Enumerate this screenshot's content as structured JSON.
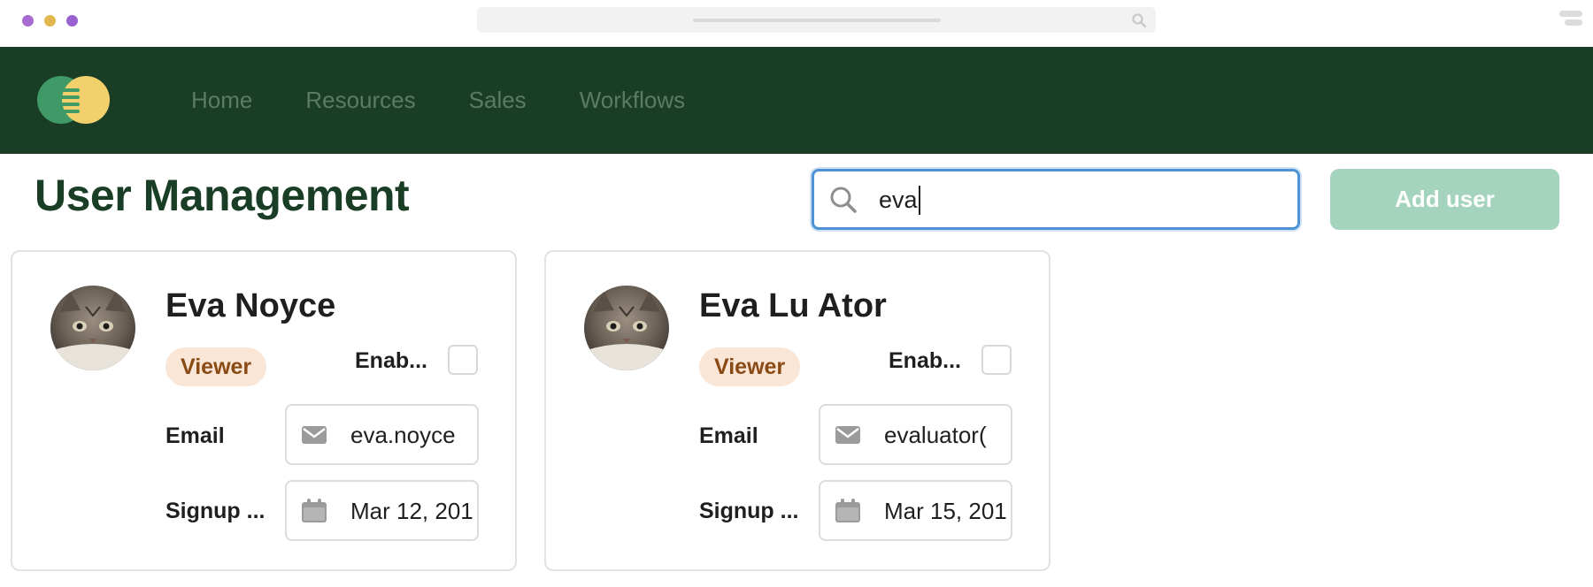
{
  "nav": {
    "links": [
      "Home",
      "Resources",
      "Sales",
      "Workflows"
    ]
  },
  "header": {
    "title": "User Management",
    "search_value": "eva",
    "add_button_label": "Add user"
  },
  "users": [
    {
      "name": "Eva Noyce",
      "role": "Viewer",
      "enabled_label": "Enab...",
      "enabled": false,
      "email_label": "Email",
      "email_value": "eva.noyce",
      "signup_label": "Signup ...",
      "signup_value": "Mar 12, 201"
    },
    {
      "name": "Eva Lu Ator",
      "role": "Viewer",
      "enabled_label": "Enab...",
      "enabled": false,
      "email_label": "Email",
      "email_value": "evaluator(",
      "signup_label": "Signup ...",
      "signup_value": "Mar 15, 201"
    }
  ],
  "colors": {
    "nav_background": "#1a3d25",
    "title": "#1a3d25",
    "add_button": "#a4d4bd",
    "badge_background": "#fae6d7",
    "badge_text": "#8a4a14",
    "search_focus": "#4e93d6"
  }
}
